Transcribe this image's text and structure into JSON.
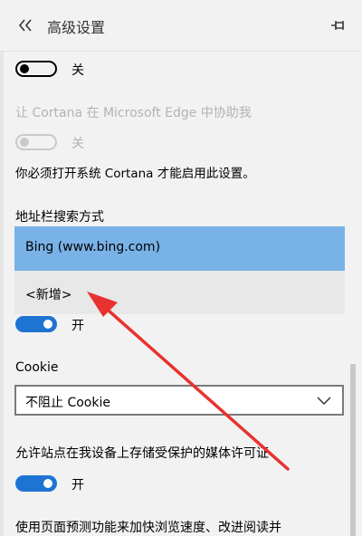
{
  "header": {
    "title": "高级设置",
    "back_icon": "double-chevron-left-icon",
    "pin_icon": "pin-icon"
  },
  "settings": {
    "toggle1_state": "关",
    "cortana_edge_label": "让 Cortana 在 Microsoft Edge 中协助我",
    "cortana_edge_state": "关",
    "cortana_note": "你必须打开系统 Cortana 才能启用此设置。",
    "search_engine_label": "地址栏搜索方式",
    "search_engine_options": [
      "Bing (www.bing.com)",
      "<新增>"
    ],
    "search_toggle_state": "开",
    "cookie_label": "Cookie",
    "cookie_value": "不阻止 Cookie",
    "media_license_label": "允许站点在我设备上存储受保护的媒体许可证",
    "media_license_state": "开",
    "page_prediction_label": "使用页面预测功能来加快浏览速度、改进阅读并"
  },
  "colors": {
    "accent": "#1e74d2",
    "selected_bg": "#79b2e6",
    "annotation_arrow": "#e8322f"
  }
}
